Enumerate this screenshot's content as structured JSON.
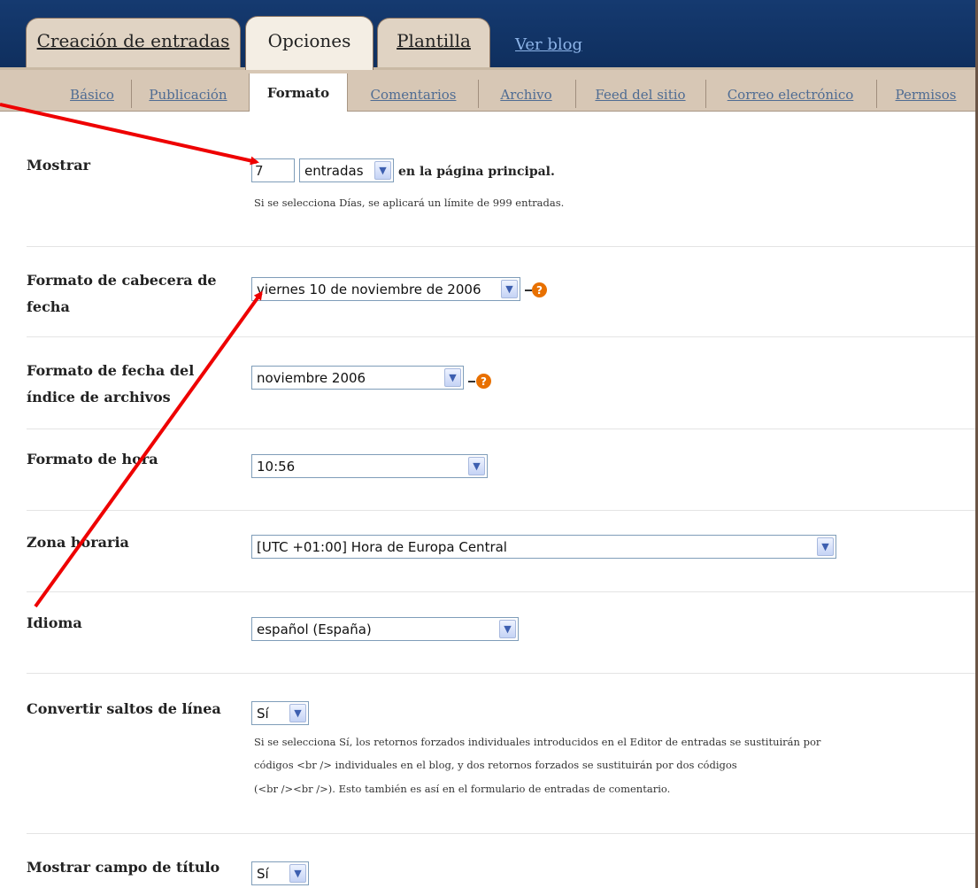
{
  "tabs": [
    {
      "label": "Creación de entradas",
      "active": false
    },
    {
      "label": "Opciones",
      "active": true
    },
    {
      "label": "Plantilla",
      "active": false
    }
  ],
  "view_blog": "Ver blog",
  "subtabs": [
    {
      "label": "Básico",
      "active": false
    },
    {
      "label": "Publicación",
      "active": false
    },
    {
      "label": "Formato",
      "active": true
    },
    {
      "label": "Comentarios",
      "active": false
    },
    {
      "label": "Archivo",
      "active": false
    },
    {
      "label": "Feed del sitio",
      "active": false
    },
    {
      "label": "Correo electrónico",
      "active": false
    },
    {
      "label": "Permisos",
      "active": false
    }
  ],
  "fields": {
    "mostrar": {
      "label": "Mostrar",
      "count": "7",
      "unit": "entradas",
      "suffix": "en la página principal.",
      "note": "Si se selecciona Días, se aplicará un límite de 999 entradas."
    },
    "cabecera_fecha": {
      "label": "Formato de cabecera de fecha",
      "value": "viernes 10 de noviembre de 2006"
    },
    "fecha_indice": {
      "label": "Formato de fecha del índice de archivos",
      "value": "noviembre 2006"
    },
    "hora": {
      "label": "Formato de hora",
      "value": "10:56"
    },
    "zona": {
      "label": "Zona horaria",
      "value": "[UTC +01:00] Hora de Europa Central"
    },
    "idioma": {
      "label": "Idioma",
      "value": "español (España)"
    },
    "saltos": {
      "label": "Convertir saltos de línea",
      "value": "Sí",
      "note_lines": [
        "Si se selecciona Sí, los retornos forzados individuales introducidos en el Editor de entradas se sustituirán por",
        "códigos <br /> individuales en el blog, y dos retornos forzados se sustituirán por dos códigos",
        "(<br /><br />). Esto también es así en el formulario de entradas de comentario."
      ]
    },
    "titulo": {
      "label": "Mostrar campo de título",
      "value": "Sí"
    }
  },
  "colors": {
    "topbar": "#153a70",
    "tab": "#e0d3c3",
    "subbar": "#d7c7b5",
    "help": "#e87000",
    "arrow": "#ee0000"
  }
}
